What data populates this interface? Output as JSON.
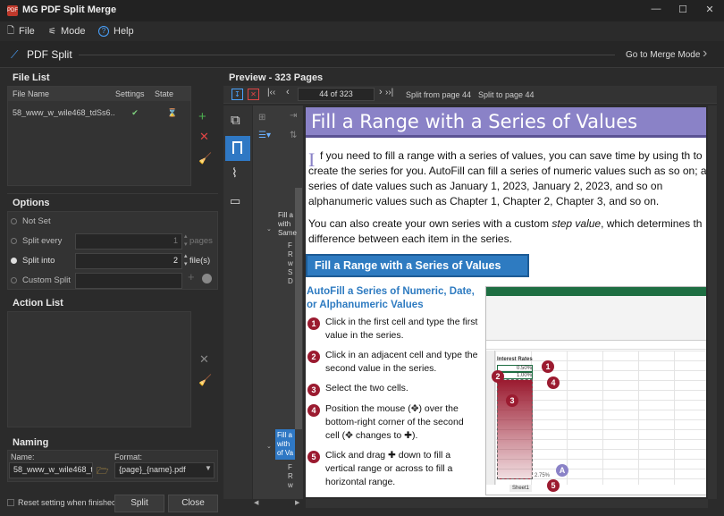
{
  "window": {
    "title": "MG PDF Split Merge",
    "app_icon_text": "PDF",
    "min": "—",
    "max": "☐",
    "close": "✕"
  },
  "menu": {
    "file": "File",
    "mode": "Mode",
    "help": "Help"
  },
  "header": {
    "title": "PDF Split",
    "merge_mode": "Go to Merge Mode"
  },
  "file_list": {
    "title": "File List",
    "columns": [
      "File Name",
      "Settings",
      "State"
    ],
    "rows": [
      {
        "name": "58_www_w_wile468_tdSs6...",
        "settings": "✔",
        "state": "⌛"
      }
    ]
  },
  "options": {
    "title": "Options",
    "not_set": "Not Set",
    "split_every": "Split every",
    "split_every_value": "1",
    "pages_unit": "pages",
    "split_into": "Split into",
    "split_into_value": "2",
    "files_unit": "file(s)",
    "custom_split": "Custom Split"
  },
  "action_list": {
    "title": "Action List"
  },
  "naming": {
    "title": "Naming",
    "name_label": "Name:",
    "name_value": "58_www_w_wile468_td",
    "format_label": "Format:",
    "format_value": "{page}_{name}.pdf"
  },
  "footer": {
    "reset": "Reset setting when finished",
    "split": "Split",
    "close": "Close"
  },
  "preview": {
    "title": "Preview - 323 Pages",
    "page_indicator": "44 of 323",
    "split_from": "Split from page 44",
    "split_to": "Split to page 44"
  },
  "outline": {
    "item1": "Fill a\nwith\nSame",
    "item2": "F\nR\nw\nS\nD",
    "item3": "Fill a\nwith\nof Va",
    "item4": "F\nR\nw"
  },
  "pdf": {
    "heading": "Fill a Range with a Series of Values",
    "drop_cap": "I",
    "para1": "f you need to fill a range with a series of values, you can save time by using th to create the series for you. AutoFill can fill a series of numeric values such as so on; a series of date values such as January 1, 2023, January 2, 2023, and so on alphanumeric values such as Chapter 1, Chapter 2, Chapter 3, and so on.",
    "para2_a": "You can also create your own series with a custom ",
    "para2_em": "step value",
    "para2_b": ", which determines th difference between each item in the series.",
    "box_title": "Fill a Range with a Series of Values",
    "subhead": "AutoFill a Series of Numeric, Date, or Alphanumeric Values",
    "steps": [
      {
        "n": "1",
        "text": "Click in the first cell and type the first value in the series."
      },
      {
        "n": "2",
        "text": "Click in an adjacent cell and type the second value in the series."
      },
      {
        "n": "3",
        "text": "Select the two cells."
      },
      {
        "n": "4",
        "text": "Position the mouse (✥) over the bottom-right corner of the second cell (✥ changes to ✚)."
      },
      {
        "n": "5",
        "text": "Click and drag ✚ down to fill a vertical range or across to fill a horizontal range."
      }
    ],
    "excel": {
      "cell_title": "Interest Rates",
      "v1": "0.50%",
      "v2": "1.00%",
      "tab": "Sheet1",
      "fill_tip": "2.75%"
    }
  }
}
